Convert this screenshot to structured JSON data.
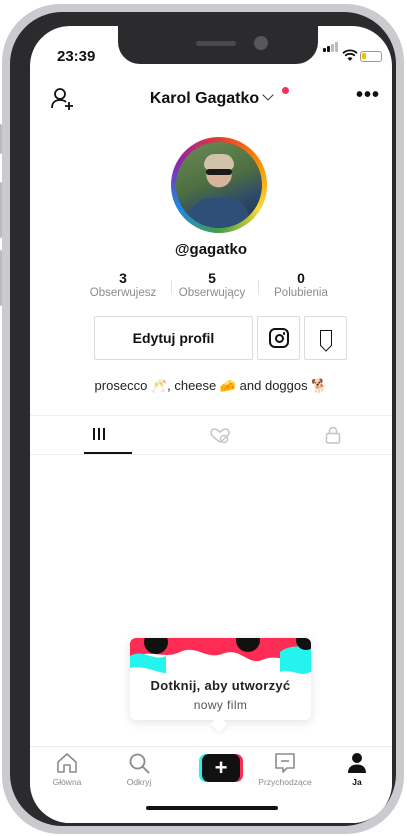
{
  "status_bar": {
    "time": "23:39"
  },
  "header": {
    "title": "Karol Gagatko"
  },
  "profile": {
    "username": "@gagatko",
    "stats": [
      {
        "value": "3",
        "label": "Obserwujesz"
      },
      {
        "value": "5",
        "label": "Obserwujący"
      },
      {
        "value": "0",
        "label": "Polubienia"
      }
    ],
    "edit_label": "Edytuj profil",
    "bio_parts": [
      "prosecco ",
      "🥂",
      ", cheese ",
      "🧀",
      " and doggos ",
      "🐕"
    ]
  },
  "tooltip": {
    "title": "Dotknij, aby utworzyć",
    "subtitle": "nowy film"
  },
  "bottom_nav": {
    "items": [
      {
        "label": "Główna",
        "icon": "home-icon"
      },
      {
        "label": "Odkryj",
        "icon": "search-icon"
      },
      {
        "label": "",
        "icon": "create-icon"
      },
      {
        "label": "Przychodzące",
        "icon": "inbox-icon"
      },
      {
        "label": "Ja",
        "icon": "profile-icon"
      }
    ]
  },
  "colors": {
    "accent_red": "#fe2c55",
    "accent_cyan": "#25f4ee",
    "text": "#111111",
    "muted": "#8a8b91"
  }
}
